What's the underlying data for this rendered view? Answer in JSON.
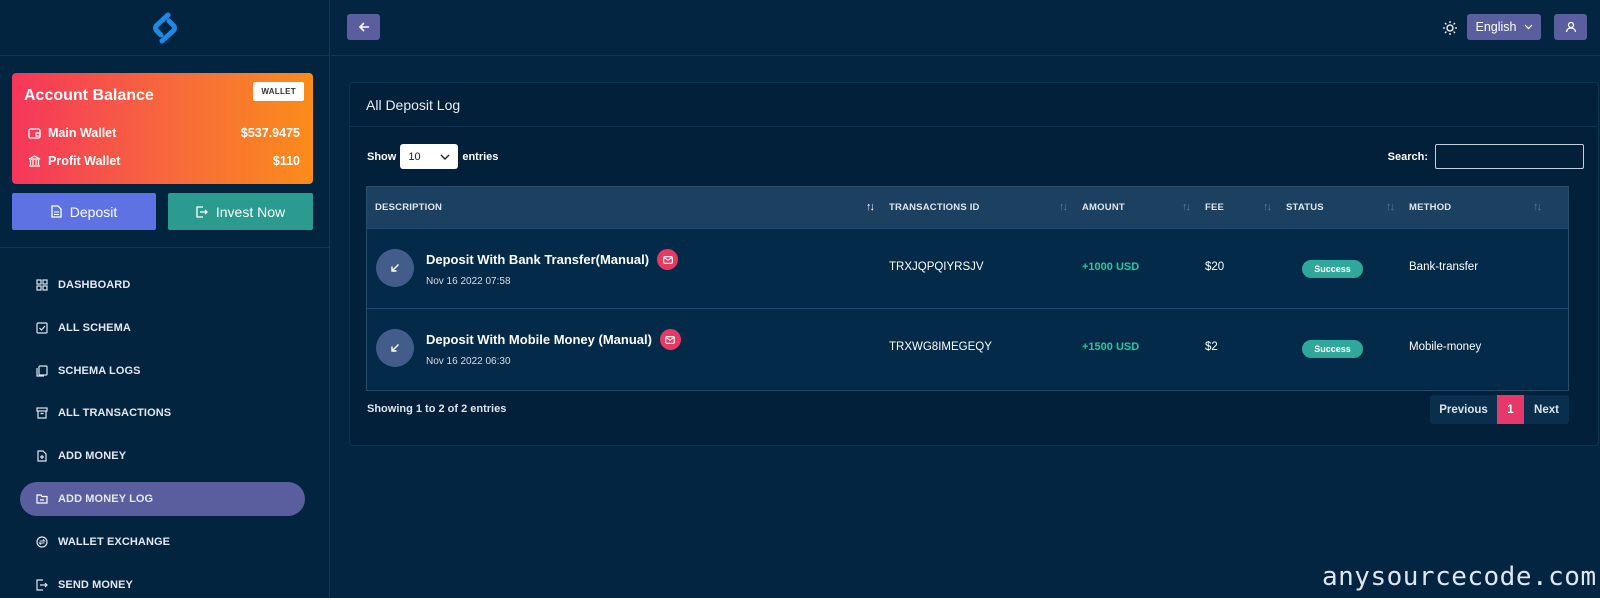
{
  "sidebar": {
    "balance": {
      "title": "Account Balance",
      "tag": "WALLET",
      "main_label": "Main Wallet",
      "main_value": "$537.9475",
      "profit_label": "Profit Wallet",
      "profit_value": "$110"
    },
    "deposit_label": "Deposit",
    "invest_label": "Invest Now",
    "nav": [
      {
        "label": "DASHBOARD",
        "icon": "dashboard-icon"
      },
      {
        "label": "ALL SCHEMA",
        "icon": "checkbox-icon"
      },
      {
        "label": "SCHEMA LOGS",
        "icon": "copy-icon"
      },
      {
        "label": "ALL TRANSACTIONS",
        "icon": "archive-icon"
      },
      {
        "label": "ADD MONEY",
        "icon": "file-plus-icon"
      },
      {
        "label": "ADD MONEY LOG",
        "icon": "folder-icon",
        "active": true
      },
      {
        "label": "WALLET EXCHANGE",
        "icon": "exchange-icon"
      },
      {
        "label": "SEND MONEY",
        "icon": "send-icon"
      }
    ]
  },
  "topbar": {
    "language": "English"
  },
  "card": {
    "title": "All Deposit Log",
    "show_label": "Show",
    "entries_value": "10",
    "entries_label": "entries",
    "search_label": "Search:",
    "search_value": "",
    "columns": [
      "DESCRIPTION",
      "TRANSACTIONS ID",
      "AMOUNT",
      "FEE",
      "STATUS",
      "METHOD"
    ],
    "rows": [
      {
        "title": "Deposit With Bank Transfer(Manual)",
        "date": "Nov 16 2022 07:58",
        "txn_id": "TRXJQPQIYRSJV",
        "amount": "+1000 USD",
        "fee": "$20",
        "status": "Success",
        "method": "Bank-transfer"
      },
      {
        "title": "Deposit With Mobile Money (Manual)",
        "date": "Nov 16 2022 06:30",
        "txn_id": "TRXWG8IMEGEQY",
        "amount": "+1500 USD",
        "fee": "$2",
        "status": "Success",
        "method": "Mobile-money"
      }
    ],
    "showing": "Showing 1 to 2 of 2 entries",
    "pager": {
      "prev": "Previous",
      "current": "1",
      "next": "Next"
    }
  },
  "watermark": "anysourcecode.com",
  "colors": {
    "background": "#032541",
    "accent": "#5a5e9e",
    "success": "#2ea89b",
    "pink": "#e6386a"
  }
}
